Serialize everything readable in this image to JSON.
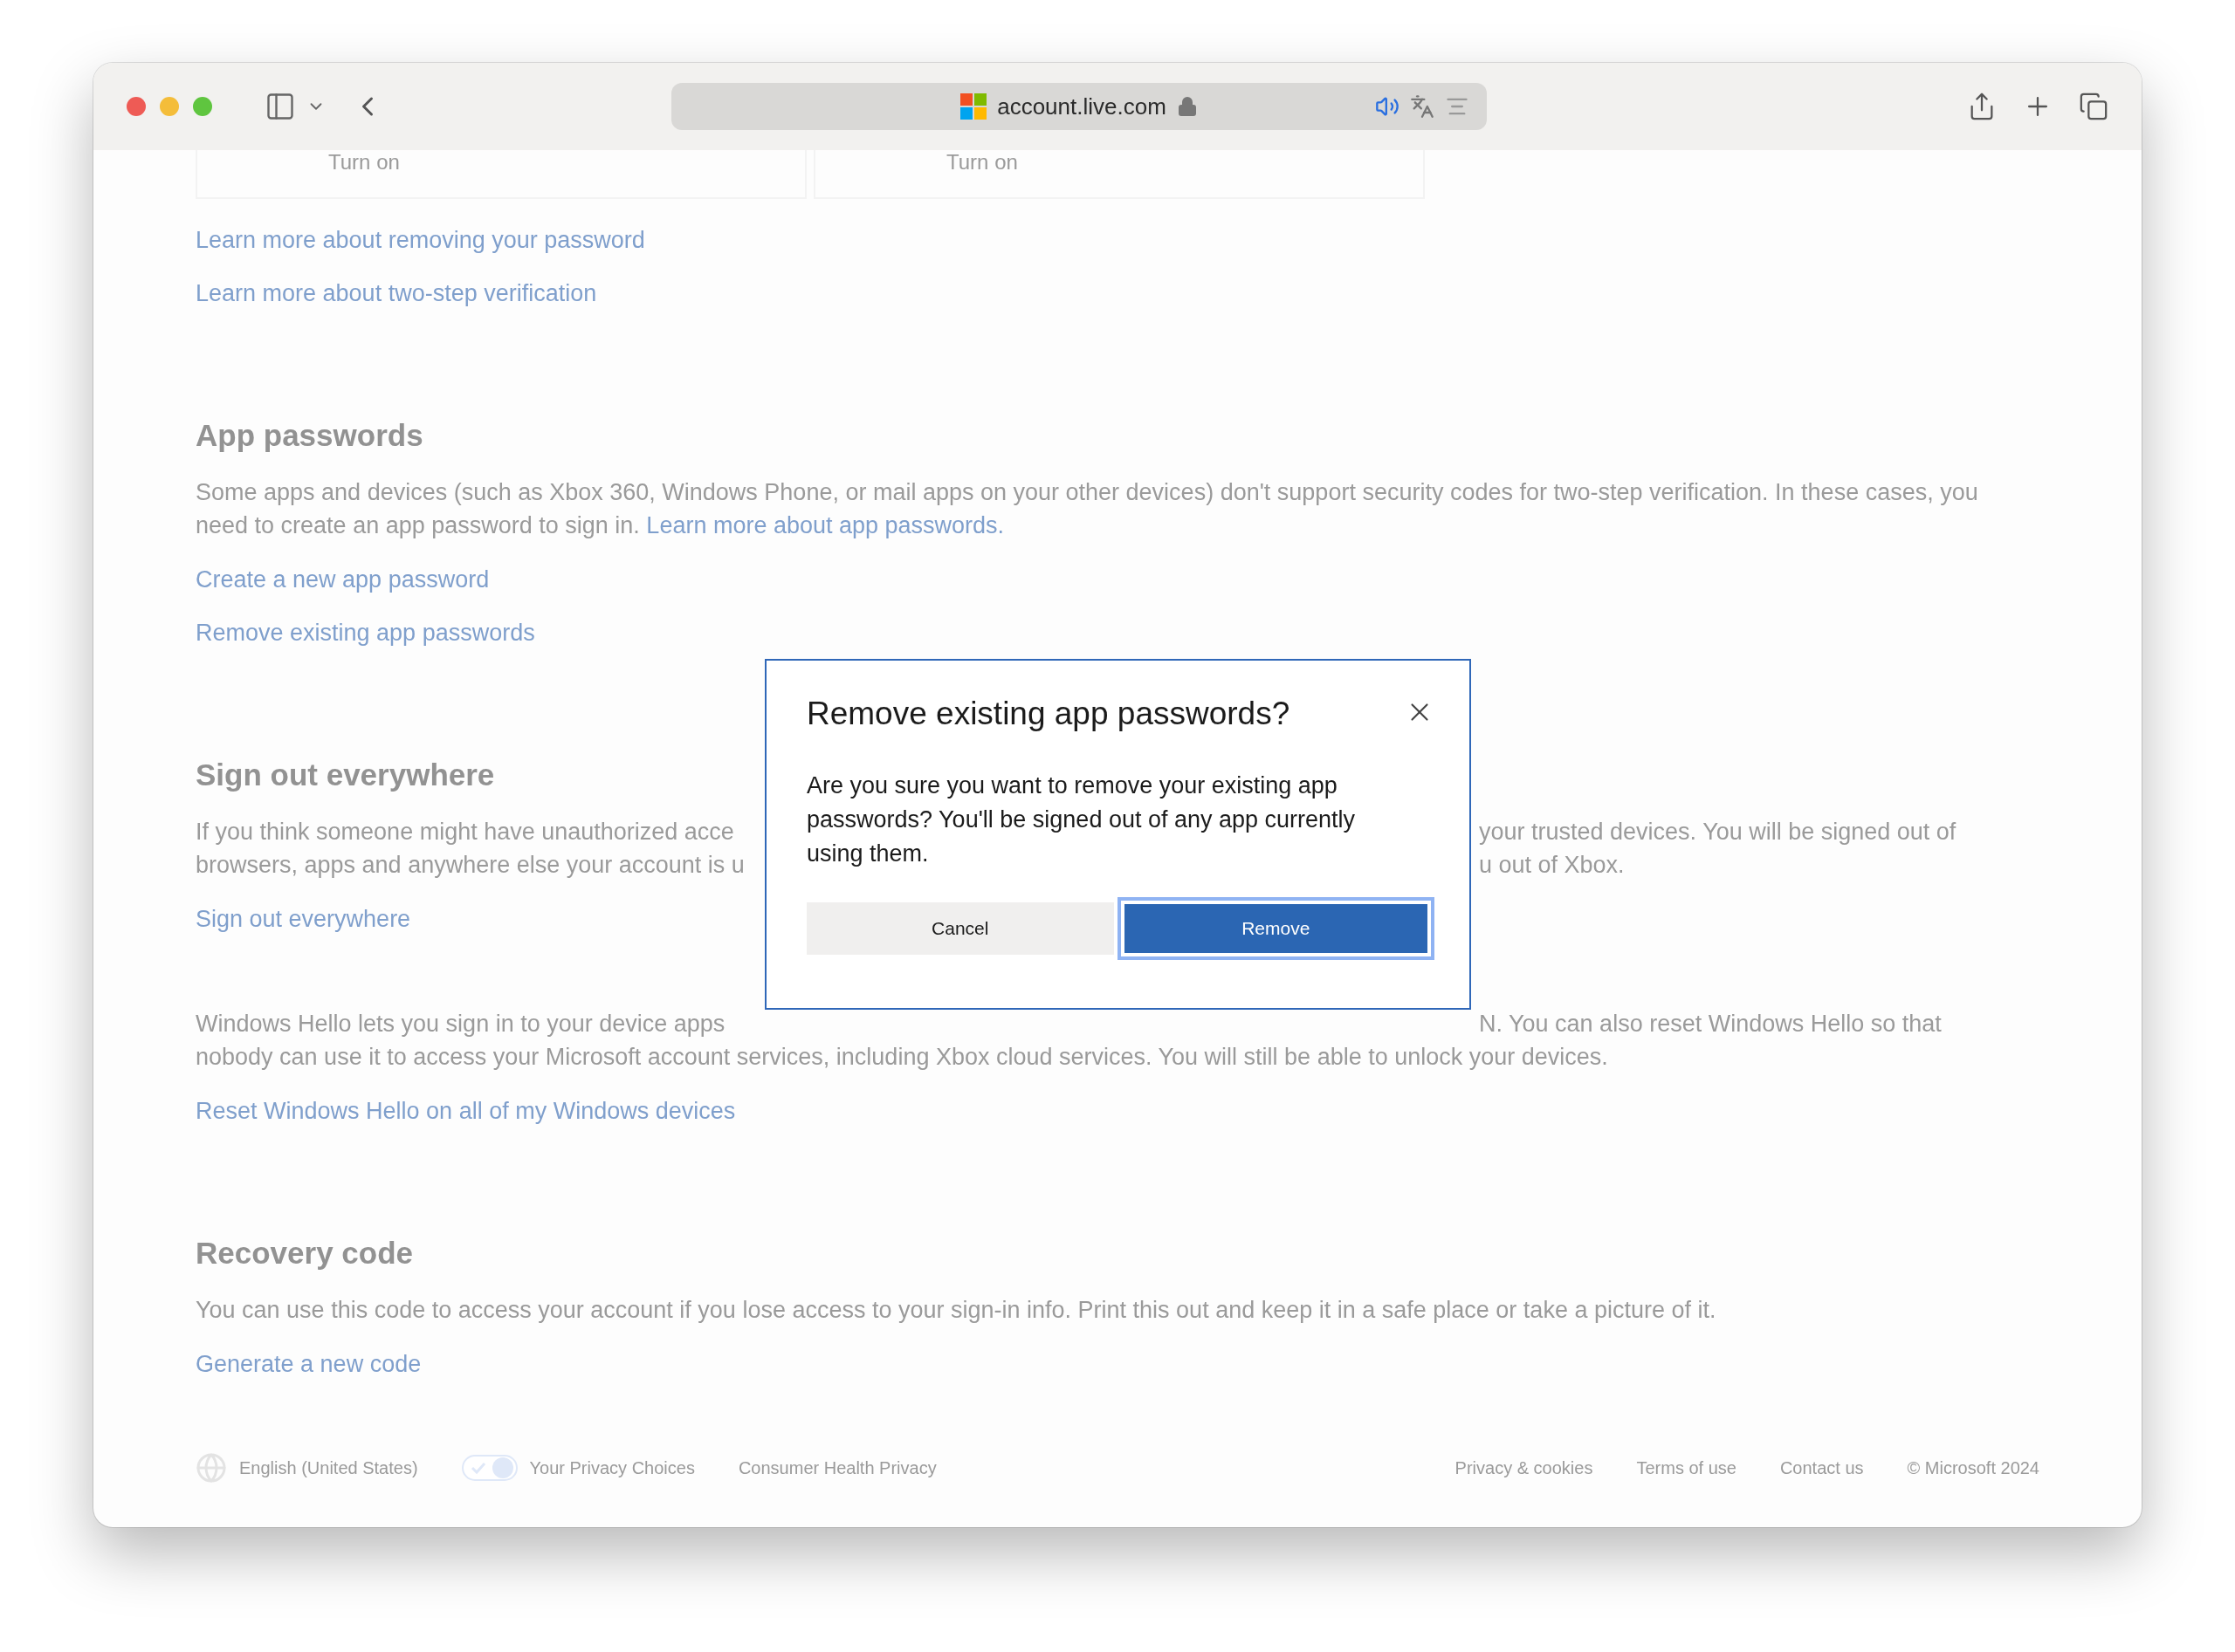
{
  "browser": {
    "url": "account.live.com"
  },
  "cards": [
    {
      "label": "Turn on"
    },
    {
      "label": "Turn on"
    }
  ],
  "top_links": [
    "Learn more about removing your password",
    "Learn more about two-step verification"
  ],
  "sections": [
    {
      "heading": "App passwords",
      "kind": "full",
      "text": "Some apps and devices (such as Xbox 360, Windows Phone, or mail apps on your other devices) don't support security codes for two-step verification. In these cases, you need to create an app password to sign in.",
      "inline_link": "Learn more about app passwords.",
      "links": [
        "Create a new app password",
        "Remove existing app passwords"
      ]
    },
    {
      "heading": "Sign out everywhere",
      "kind": "covered",
      "lines": [
        {
          "left": "If you think someone might have unauthorized acce",
          "right": "your trusted devices. You will be signed out of"
        },
        {
          "left": "browsers, apps and anywhere else your account is u",
          "right": "u out of Xbox."
        }
      ],
      "links": [
        "Sign out everywhere"
      ]
    },
    {
      "kind": "covered",
      "lines": [
        {
          "left": "Windows Hello lets you sign in to your device apps",
          "right": "N. You can also reset Windows Hello so that"
        },
        {
          "left": "nobody can use it to access your Microsoft account services, including Xbox cloud services. You will still be able to unlock your devices."
        }
      ],
      "links": [
        "Reset Windows Hello on all of my Windows devices"
      ]
    },
    {
      "heading": "Recovery code",
      "kind": "full",
      "text": "You can use this code to access your account if you lose access to your sign-in info. Print this out and keep it in a safe place or take a picture of it.",
      "links": [
        "Generate a new code"
      ]
    }
  ],
  "footer": {
    "left": [
      {
        "kind": "language",
        "label": "English (United States)"
      },
      {
        "kind": "privacy",
        "label": "Your Privacy Choices"
      },
      {
        "kind": "plain",
        "label": "Consumer Health Privacy"
      }
    ],
    "right": [
      "Privacy & cookies",
      "Terms of use",
      "Contact us",
      "© Microsoft 2024"
    ]
  },
  "dialog": {
    "title": "Remove existing app passwords?",
    "body": "Are you sure you want to remove your existing app passwords? You'll be signed out of any app currently using them.",
    "buttons": [
      {
        "label": "Cancel",
        "kind": "secondary",
        "focused": false
      },
      {
        "label": "Remove",
        "kind": "primary",
        "focused": true
      }
    ]
  }
}
